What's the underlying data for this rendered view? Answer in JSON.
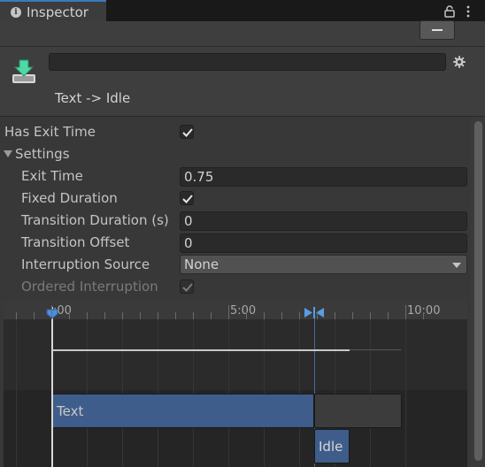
{
  "tab": {
    "title": "Inspector",
    "info_icon": "i"
  },
  "header": {
    "collapse_label": "—",
    "name_value": "",
    "transition_title": "Text -> Idle"
  },
  "properties": {
    "has_exit_time": {
      "label": "Has Exit Time",
      "checked": true
    },
    "settings": {
      "label": "Settings",
      "expanded": true
    },
    "exit_time": {
      "label": "Exit Time",
      "value": "0.75"
    },
    "fixed_duration": {
      "label": "Fixed Duration",
      "checked": true
    },
    "transition_duration": {
      "label": "Transition Duration (s)",
      "value": "0"
    },
    "transition_offset": {
      "label": "Transition Offset",
      "value": "0"
    },
    "interruption_source": {
      "label": "Interruption Source",
      "value": "None"
    },
    "ordered_interruption": {
      "label": "Ordered Interruption",
      "checked": true,
      "disabled": true
    }
  },
  "timeline": {
    "ruler_labels": [
      ":00",
      "5:00",
      "10:00"
    ],
    "clips": {
      "source": "Text",
      "destination": "Idle"
    }
  },
  "colors": {
    "accent": "#3a79bb",
    "clip_blue": "#3e5d8a",
    "panel": "#383838",
    "transition_icon": "#4fd9a6"
  }
}
